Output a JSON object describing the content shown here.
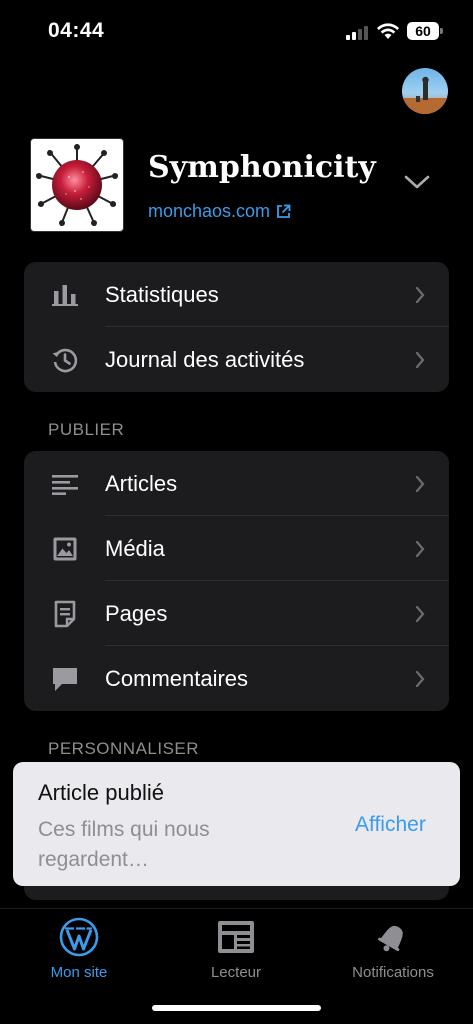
{
  "status_bar": {
    "time": "04:44",
    "battery": "60",
    "icons": [
      "signal-icon",
      "wifi-icon",
      "battery-icon"
    ]
  },
  "header": {
    "avatar_icon": "user-avatar",
    "site_title": "Symphonicity",
    "site_url": "monchaos.com",
    "url_icon": "external-link-icon",
    "switch_icon": "chevron-down-icon"
  },
  "menu_top": [
    {
      "label": "Statistiques",
      "icon": "stats-icon"
    },
    {
      "label": "Journal des activités",
      "icon": "history-icon"
    }
  ],
  "publish": {
    "title": "PUBLIER",
    "items": [
      {
        "label": "Articles",
        "icon": "posts-icon"
      },
      {
        "label": "Média",
        "icon": "media-icon"
      },
      {
        "label": "Pages",
        "icon": "pages-icon"
      },
      {
        "label": "Commentaires",
        "icon": "comments-icon"
      }
    ]
  },
  "personalize": {
    "title": "PERSONNALISER"
  },
  "toast": {
    "title": "Article publié",
    "message": "Ces films qui nous regardent…",
    "action": "Afficher"
  },
  "tabs": [
    {
      "label": "Mon site",
      "icon": "wordpress-icon",
      "active": true
    },
    {
      "label": "Lecteur",
      "icon": "reader-icon",
      "active": false
    },
    {
      "label": "Notifications",
      "icon": "bell-icon",
      "active": false
    }
  ],
  "colors": {
    "accent": "#3d9be9",
    "background": "#000000",
    "card": "#1c1c1e",
    "secondary_text": "#8e8e93",
    "toast_background": "#e9e9ee"
  }
}
